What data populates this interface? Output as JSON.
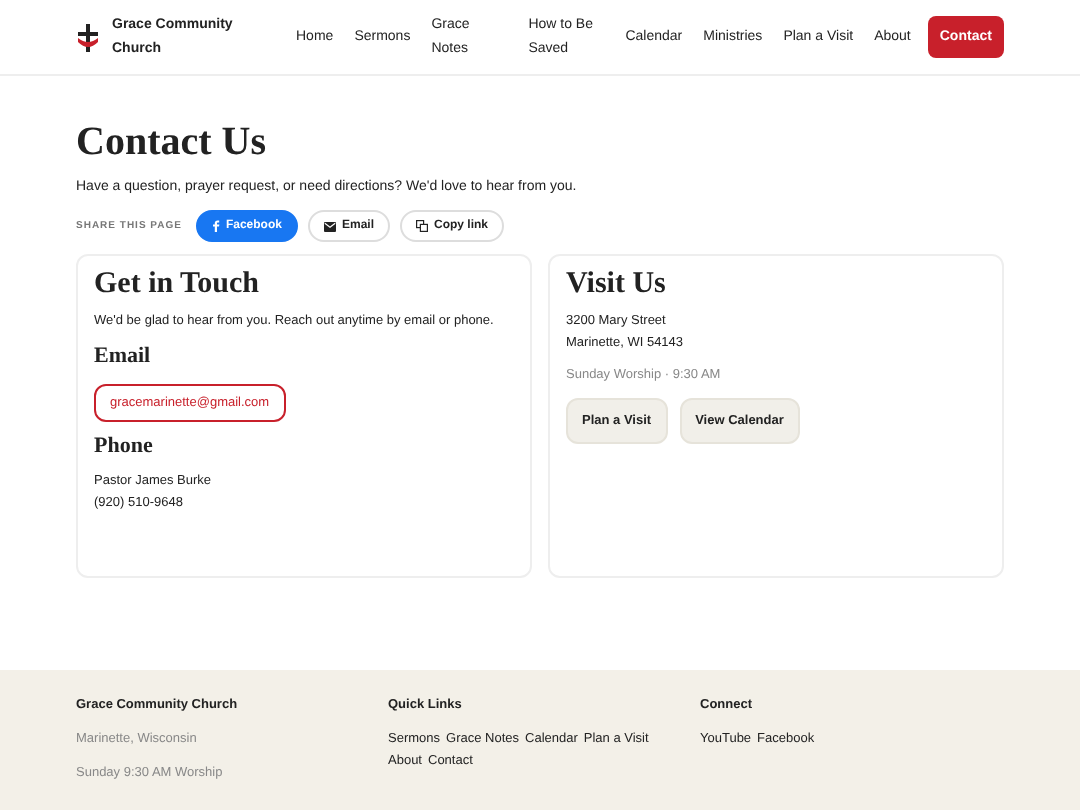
{
  "header": {
    "brand": "Grace Community Church",
    "nav": [
      {
        "label": "Home",
        "selected": false
      },
      {
        "label": "Sermons",
        "selected": false
      },
      {
        "label": "Grace Notes",
        "selected": false
      },
      {
        "label": "How to Be Saved",
        "selected": false
      },
      {
        "label": "Calendar",
        "selected": false
      },
      {
        "label": "Ministries",
        "selected": false
      },
      {
        "label": "Plan a Visit",
        "selected": false
      },
      {
        "label": "About",
        "selected": false
      },
      {
        "label": "Contact",
        "selected": true
      }
    ]
  },
  "page": {
    "title": "Contact Us",
    "intro": "Have a question, prayer request, or need directions? We'd love to hear from you.",
    "share": {
      "label": "SHARE THIS PAGE",
      "buttons": [
        {
          "kind": "facebook",
          "label": "Facebook"
        },
        {
          "kind": "email",
          "label": "Email"
        },
        {
          "kind": "copy",
          "label": "Copy link"
        }
      ]
    }
  },
  "get_in_touch": {
    "title": "Get in Touch",
    "text": "We'd be glad to hear from you. Reach out anytime by email or phone.",
    "email_heading": "Email",
    "email": "gracemarinette@gmail.com",
    "phone_heading": "Phone",
    "contact_name": "Pastor James Burke",
    "phone": "(920) 510-9648"
  },
  "visit_us": {
    "title": "Visit Us",
    "address": [
      "3200 Mary Street",
      "Marinette, WI 54143"
    ],
    "worship": "Sunday Worship · 9:30 AM",
    "buttons": [
      "Plan a Visit",
      "View Calendar"
    ]
  },
  "footer": {
    "columns": [
      {
        "title": "Grace Community Church",
        "lines": [
          "Marinette, Wisconsin",
          "Sunday 9:30 AM Worship"
        ]
      },
      {
        "title": "Quick Links",
        "links": [
          "Sermons",
          "Grace Notes",
          "Calendar",
          "Plan a Visit",
          "About",
          "Contact"
        ]
      },
      {
        "title": "Connect",
        "links": [
          "YouTube",
          "Facebook"
        ]
      }
    ]
  }
}
